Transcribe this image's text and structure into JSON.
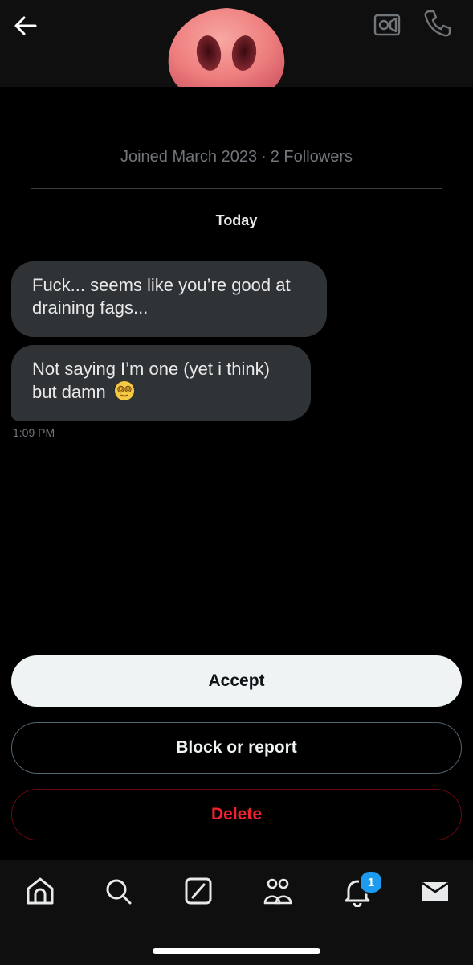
{
  "header": {
    "back_icon": "arrow-left-icon",
    "avatar_icon": "pig-nose-avatar",
    "video_icon": "video-call-icon",
    "call_icon": "phone-icon"
  },
  "profile": {
    "joined": "Joined March 2023",
    "separator": "·",
    "followers": "2 Followers"
  },
  "conversation": {
    "date_label": "Today",
    "messages": [
      {
        "text": "Fuck... seems like you’re good at draining fags..."
      },
      {
        "text": "Not saying I’m one (yet i think) but damn",
        "emoji": "face-with-spiral-eyes"
      }
    ],
    "timestamp": "1:09 PM"
  },
  "actions": {
    "accept": "Accept",
    "block": "Block or report",
    "delete": "Delete"
  },
  "nav": {
    "items": [
      "home-icon",
      "search-icon",
      "grok-icon",
      "communities-icon",
      "notifications-icon",
      "messages-icon"
    ],
    "notification_count": "1"
  },
  "colors": {
    "background": "#000000",
    "bubble": "#2f3336",
    "accent": "#1d9bf0",
    "danger": "#f4212e",
    "muted": "#71767b"
  }
}
